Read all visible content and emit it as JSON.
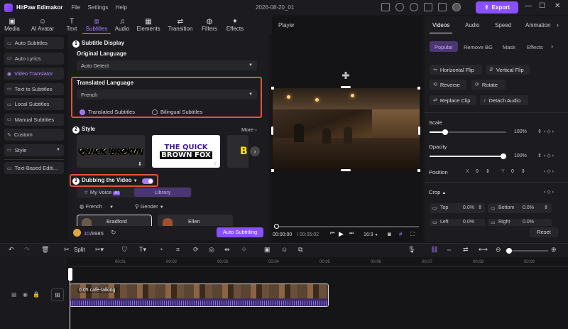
{
  "app": {
    "name": "HitPaw Edimakor",
    "menu": [
      "File",
      "Settings",
      "Help"
    ],
    "project_title": "2026-08-20_01",
    "export_label": "Export"
  },
  "top_tabs": [
    {
      "label": "Media",
      "icon": "media-icon"
    },
    {
      "label": "AI Avatar",
      "icon": "avatar-icon"
    },
    {
      "label": "Text",
      "icon": "text-icon"
    },
    {
      "label": "Subtitles",
      "icon": "subtitles-icon",
      "active": true
    },
    {
      "label": "Audio",
      "icon": "audio-icon"
    },
    {
      "label": "Elements",
      "icon": "elements-icon"
    },
    {
      "label": "Transition",
      "icon": "transition-icon"
    },
    {
      "label": "Filters",
      "icon": "filters-icon"
    },
    {
      "label": "Effects",
      "icon": "effects-icon"
    }
  ],
  "left_nav": [
    "Auto Subtitles",
    "Auto Lyrics",
    "Video Translator",
    "Text to Subtitles",
    "Local Subtitles",
    "Manual Subtitles",
    "Custom",
    "Style",
    "Text-Based Editi..."
  ],
  "subtitle": {
    "section1": "Subtitle Display",
    "original_language_label": "Original Language",
    "original_language_value": "Auto Detect",
    "translated_language_label": "Translated Language",
    "translated_language_value": "French",
    "radio_translated": "Translated Subtitles",
    "radio_bilingual": "Bilingual Subtitles",
    "section2": "Style",
    "more": "More",
    "style_card1": "QUICK BROWN",
    "style_card2a": "THE QUICK",
    "style_card2b": "BROWN FOX",
    "style_card3": "B",
    "section3": "Dubbing the Video",
    "my_voice": "My Voice",
    "ai_badge": "AI",
    "library": "Library",
    "lang_filter": "French",
    "gender_filter": "Gender",
    "voice1": "Bradford",
    "voice2": "Ellen"
  },
  "credits": {
    "used": "10",
    "total": "/8985",
    "auto_label": "Auto Subtitling"
  },
  "player": {
    "title": "Player",
    "time_current": "00:00:00",
    "time_total": "/ 00:05:02",
    "ratio": "16:9"
  },
  "right_panel": {
    "tabs": [
      "Videos",
      "Audio",
      "Speed",
      "Animation"
    ],
    "subtabs": [
      "Popular",
      "Remove BG",
      "Mask",
      "Effects"
    ],
    "buttons": [
      [
        "Horizontal Flip",
        "Vertical Flip"
      ],
      [
        "Reverse",
        "Rotate"
      ],
      [
        "Replace Clip",
        "Detach Audio"
      ]
    ],
    "scale_label": "Scale",
    "scale_value": "100%",
    "opacity_label": "Opacity",
    "opacity_value": "100%",
    "position_label": "Position",
    "pos_x_label": "X",
    "pos_x": "0",
    "pos_y_label": "Y",
    "pos_y": "0",
    "crop_label": "Crop",
    "crop_top_label": "Top",
    "crop_top": "0.0%",
    "crop_bottom_label": "Bottom",
    "crop_bottom": "0.0%",
    "crop_left_label": "Left",
    "crop_left": "0.0%",
    "crop_right_label": "Right",
    "crop_right": "0.0%",
    "reset_label": "Reset"
  },
  "toolbar": {
    "split_label": "Split"
  },
  "timeline": {
    "ticks": [
      "00:01",
      "00:02",
      "00:03",
      "00:04",
      "00:05",
      "00:06",
      "00:07",
      "00:08",
      "00:09"
    ],
    "clip_label": "0:05 cafe-talking"
  },
  "colors": {
    "accent": "#8a4fff",
    "highlight": "#e0553a",
    "bg": "#17171a"
  }
}
